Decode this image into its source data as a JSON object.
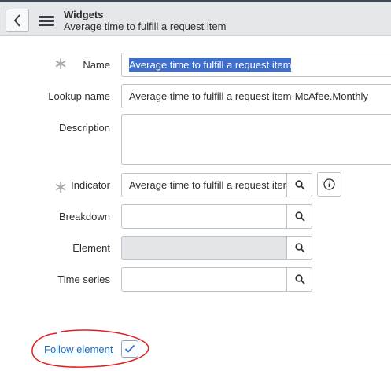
{
  "header": {
    "title": "Widgets",
    "subtitle": "Average time to fulfill a request item"
  },
  "form": {
    "name": {
      "label": "Name",
      "required": true,
      "value": "Average time to fulfill a request item",
      "selected": true
    },
    "lookup_name": {
      "label": "Lookup name",
      "value": "Average time to fulfill a request item-McAfee.Monthly"
    },
    "description": {
      "label": "Description",
      "value": ""
    },
    "indicator": {
      "label": "Indicator",
      "required": true,
      "value": "Average time to fulfill a request iten"
    },
    "breakdown": {
      "label": "Breakdown",
      "value": ""
    },
    "element": {
      "label": "Element",
      "value": "",
      "disabled": true
    },
    "time_series": {
      "label": "Time series",
      "value": ""
    },
    "follow_element": {
      "label": "Follow element",
      "checked": true
    }
  },
  "icons": {
    "back": "chevron-left-icon",
    "menu": "hamburger-menu-icon",
    "lookup": "search-icon",
    "info": "info-icon",
    "check": "checkmark-icon",
    "required": "asterisk-icon"
  },
  "colors": {
    "header_bg": "#e5e8eb",
    "link": "#1f6fbf",
    "selection": "#3d6fce",
    "annotation": "#e0201c",
    "disabled_field": "#e3e5e8"
  }
}
